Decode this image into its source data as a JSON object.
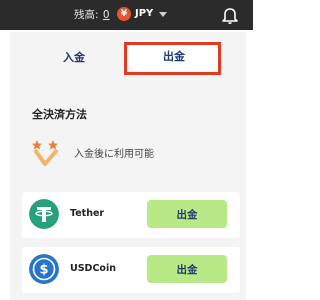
{
  "header": {
    "balance_label": "残高:",
    "balance_value": "0",
    "currency_label": "JPY",
    "icons": [
      "currency-coin-icon",
      "chevron-down-icon",
      "bell-icon"
    ]
  },
  "tabs": [
    {
      "label": "入金",
      "active": false
    },
    {
      "label": "出金",
      "active": true
    }
  ],
  "section": {
    "title": "全決済方法",
    "note_text": "入金後に利用可能",
    "note_icon": "stars-badge-icon"
  },
  "methods": [
    {
      "name": "Tether",
      "button_label": "出金",
      "icon": "tether-icon",
      "color": "#26a17b"
    },
    {
      "name": "USDCoin",
      "button_label": "出金",
      "icon": "usdc-icon",
      "color": "#2775ca"
    }
  ],
  "colors": {
    "topbar": "#2b2b2b",
    "panel": "#f4f4f4",
    "button": "#b9e887",
    "highlight": "#e03a25",
    "text_navy": "#1e3a6e"
  }
}
